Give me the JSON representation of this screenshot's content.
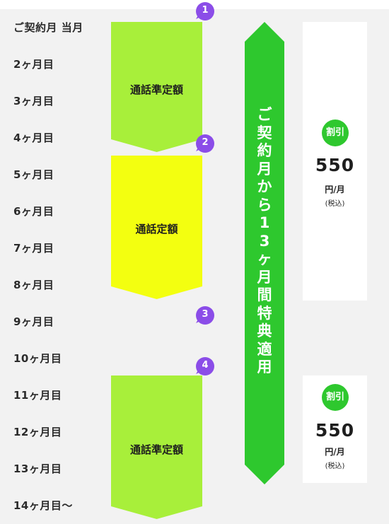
{
  "colors": {
    "row_bg": "#f2f2f2",
    "lime": "#a8ef3a",
    "yellow": "#f3ff10",
    "green": "#2ec82e",
    "purple": "#8b4de8",
    "white": "#ffffff"
  },
  "months": [
    "ご契約月 当月",
    "2ヶ月目",
    "3ヶ月目",
    "4ヶ月目",
    "5ヶ月目",
    "6ヶ月目",
    "7ヶ月目",
    "8ヶ月目",
    "9ヶ月目",
    "10ヶ月目",
    "11ヶ月目",
    "12ヶ月目",
    "13ヶ月目",
    "14ヶ月目〜"
  ],
  "blocks": {
    "first": {
      "label": "通話準定額"
    },
    "second": {
      "label": "通話定額"
    },
    "fourth": {
      "label": "通話準定額"
    }
  },
  "badges": [
    "1",
    "2",
    "3",
    "4"
  ],
  "long_arrow": {
    "text": "ご契約月から13ヶ月間特典適用"
  },
  "discounts": [
    {
      "badge": "割引",
      "amount": "550",
      "unit": "円/月",
      "tax": "(税込)"
    },
    {
      "badge": "割引",
      "amount": "550",
      "unit": "円/月",
      "tax": "(税込)"
    }
  ]
}
